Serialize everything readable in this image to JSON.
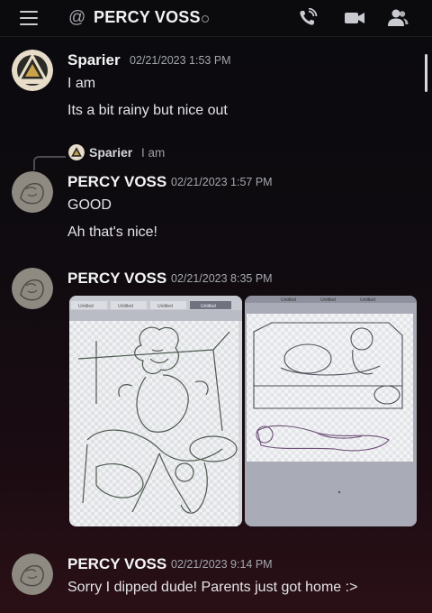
{
  "header": {
    "at_symbol": "@",
    "title": "PERCY VOSS",
    "icons": [
      "menu-icon",
      "phone-call-icon",
      "video-call-icon",
      "members-icon"
    ]
  },
  "colors": {
    "background_top": "#0a0a0d",
    "background_bottom": "#2a1016",
    "text_primary": "#f4f4f6",
    "text_muted": "#a3a6ad"
  },
  "messages": [
    {
      "author": "Sparier",
      "timestamp": "02/21/2023 1:53 PM",
      "lines": [
        "I am",
        "Its a bit rainy but nice out"
      ]
    },
    {
      "reply": {
        "author": "Sparier",
        "text": "I am"
      },
      "author": "PERCY VOSS",
      "timestamp": "02/21/2023 1:57 PM",
      "lines": [
        "GOOD",
        "Ah that's nice!"
      ]
    },
    {
      "author": "PERCY VOSS",
      "timestamp": "02/21/2023 8:35 PM",
      "attachments": [
        {
          "kind": "image",
          "tabs": [
            "Untitled",
            "Untitled",
            "Untitled",
            "Untitled"
          ]
        },
        {
          "kind": "image",
          "tabs": [
            "Untitled",
            "Untitled",
            "Untitled"
          ]
        }
      ]
    },
    {
      "author": "PERCY VOSS",
      "timestamp": "02/21/2023 9:14 PM",
      "lines": [
        "Sorry I dipped dude! Parents just got home :>"
      ]
    }
  ]
}
